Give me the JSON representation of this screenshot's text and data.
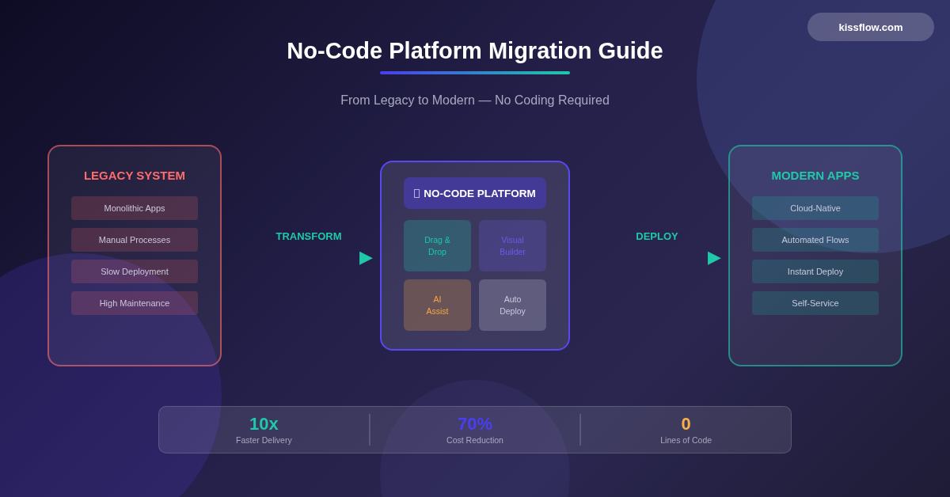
{
  "badge": "kissflow.com",
  "title": "No-Code Platform Migration Guide",
  "subtitle": "From Legacy to Modern — No Coding Required",
  "legacy": {
    "title": "LEGACY SYSTEM",
    "color": "#ff6b6b",
    "items": [
      "Monolithic Apps",
      "Manual Processes",
      "Slow Deployment",
      "High Maintenance"
    ]
  },
  "connectors": [
    {
      "label": "TRANSFORM",
      "arrow": "▶"
    },
    {
      "label": "DEPLOY",
      "arrow": "▶"
    }
  ],
  "platform": {
    "title": "NO-CODE PLATFORM",
    "tiles": [
      {
        "label": "Drag &\nDrop",
        "color": "#1ec8a8"
      },
      {
        "label": "Visual\nBuilder",
        "color": "#6b5be6"
      },
      {
        "label": "AI\nAssist",
        "color": "#f5a742"
      },
      {
        "label": "Auto\nDeploy",
        "color": "#c8c8dc"
      }
    ]
  },
  "modern": {
    "title": "MODERN APPS",
    "color": "#1ec8a8",
    "items": [
      "Cloud-Native",
      "Automated Flows",
      "Instant Deploy",
      "Self-Service"
    ]
  },
  "stats": [
    {
      "value": "10x",
      "label": "Faster Delivery",
      "color": "#1ec8a8"
    },
    {
      "value": "70%",
      "label": "Cost Reduction",
      "color": "#4a3ef0"
    },
    {
      "value": "0",
      "label": "Lines of Code",
      "color": "#f5b04a"
    }
  ]
}
